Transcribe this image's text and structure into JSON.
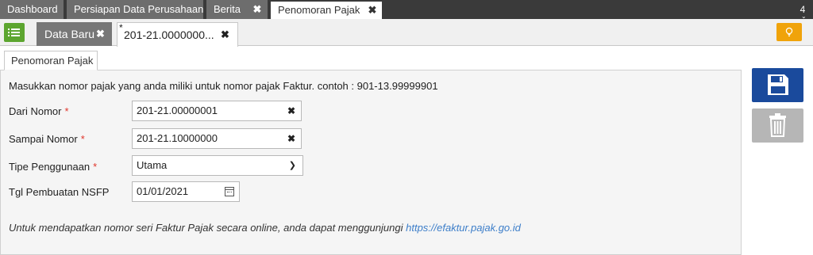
{
  "top_tabs": [
    {
      "label": "Dashboard"
    },
    {
      "label": "Persiapan Data Perusahaan"
    },
    {
      "label": "Berita"
    },
    {
      "label": "Penomoran Pajak"
    }
  ],
  "tab_count": "4",
  "sub_tabs": {
    "data_baru": "Data Baru",
    "modified_marker": "*",
    "record": "201-21.0000000..."
  },
  "form_tab": "Penomoran Pajak",
  "info_text": "Masukkan nomor pajak yang anda miliki untuk nomor pajak Faktur. contoh : 901-13.99999901",
  "fields": {
    "dari_nomor": {
      "label": "Dari Nomor",
      "value": "201-21.00000001"
    },
    "sampai_nomor": {
      "label": "Sampai Nomor",
      "value": "201-21.10000000"
    },
    "tipe": {
      "label": "Tipe Penggunaan",
      "value": "Utama"
    },
    "tgl": {
      "label": "Tgl Pembuatan NSFP",
      "value": "01/01/2021"
    }
  },
  "required_marker": "*",
  "footnote": {
    "text": "Untuk mendapatkan nomor seri Faktur Pajak secara online, anda dapat menggunjungi",
    "link": "https://efaktur.pajak.go.id"
  },
  "icons": {
    "menu": "list-icon",
    "bulb": "lightbulb-icon",
    "save": "floppy-disk-icon",
    "delete": "trash-icon"
  },
  "colors": {
    "menu_green": "#5ca52f",
    "save_blue": "#1a4a9c",
    "bulb_orange": "#f0a30a",
    "required_red": "#e0352b",
    "link_blue": "#3d7ec9"
  }
}
